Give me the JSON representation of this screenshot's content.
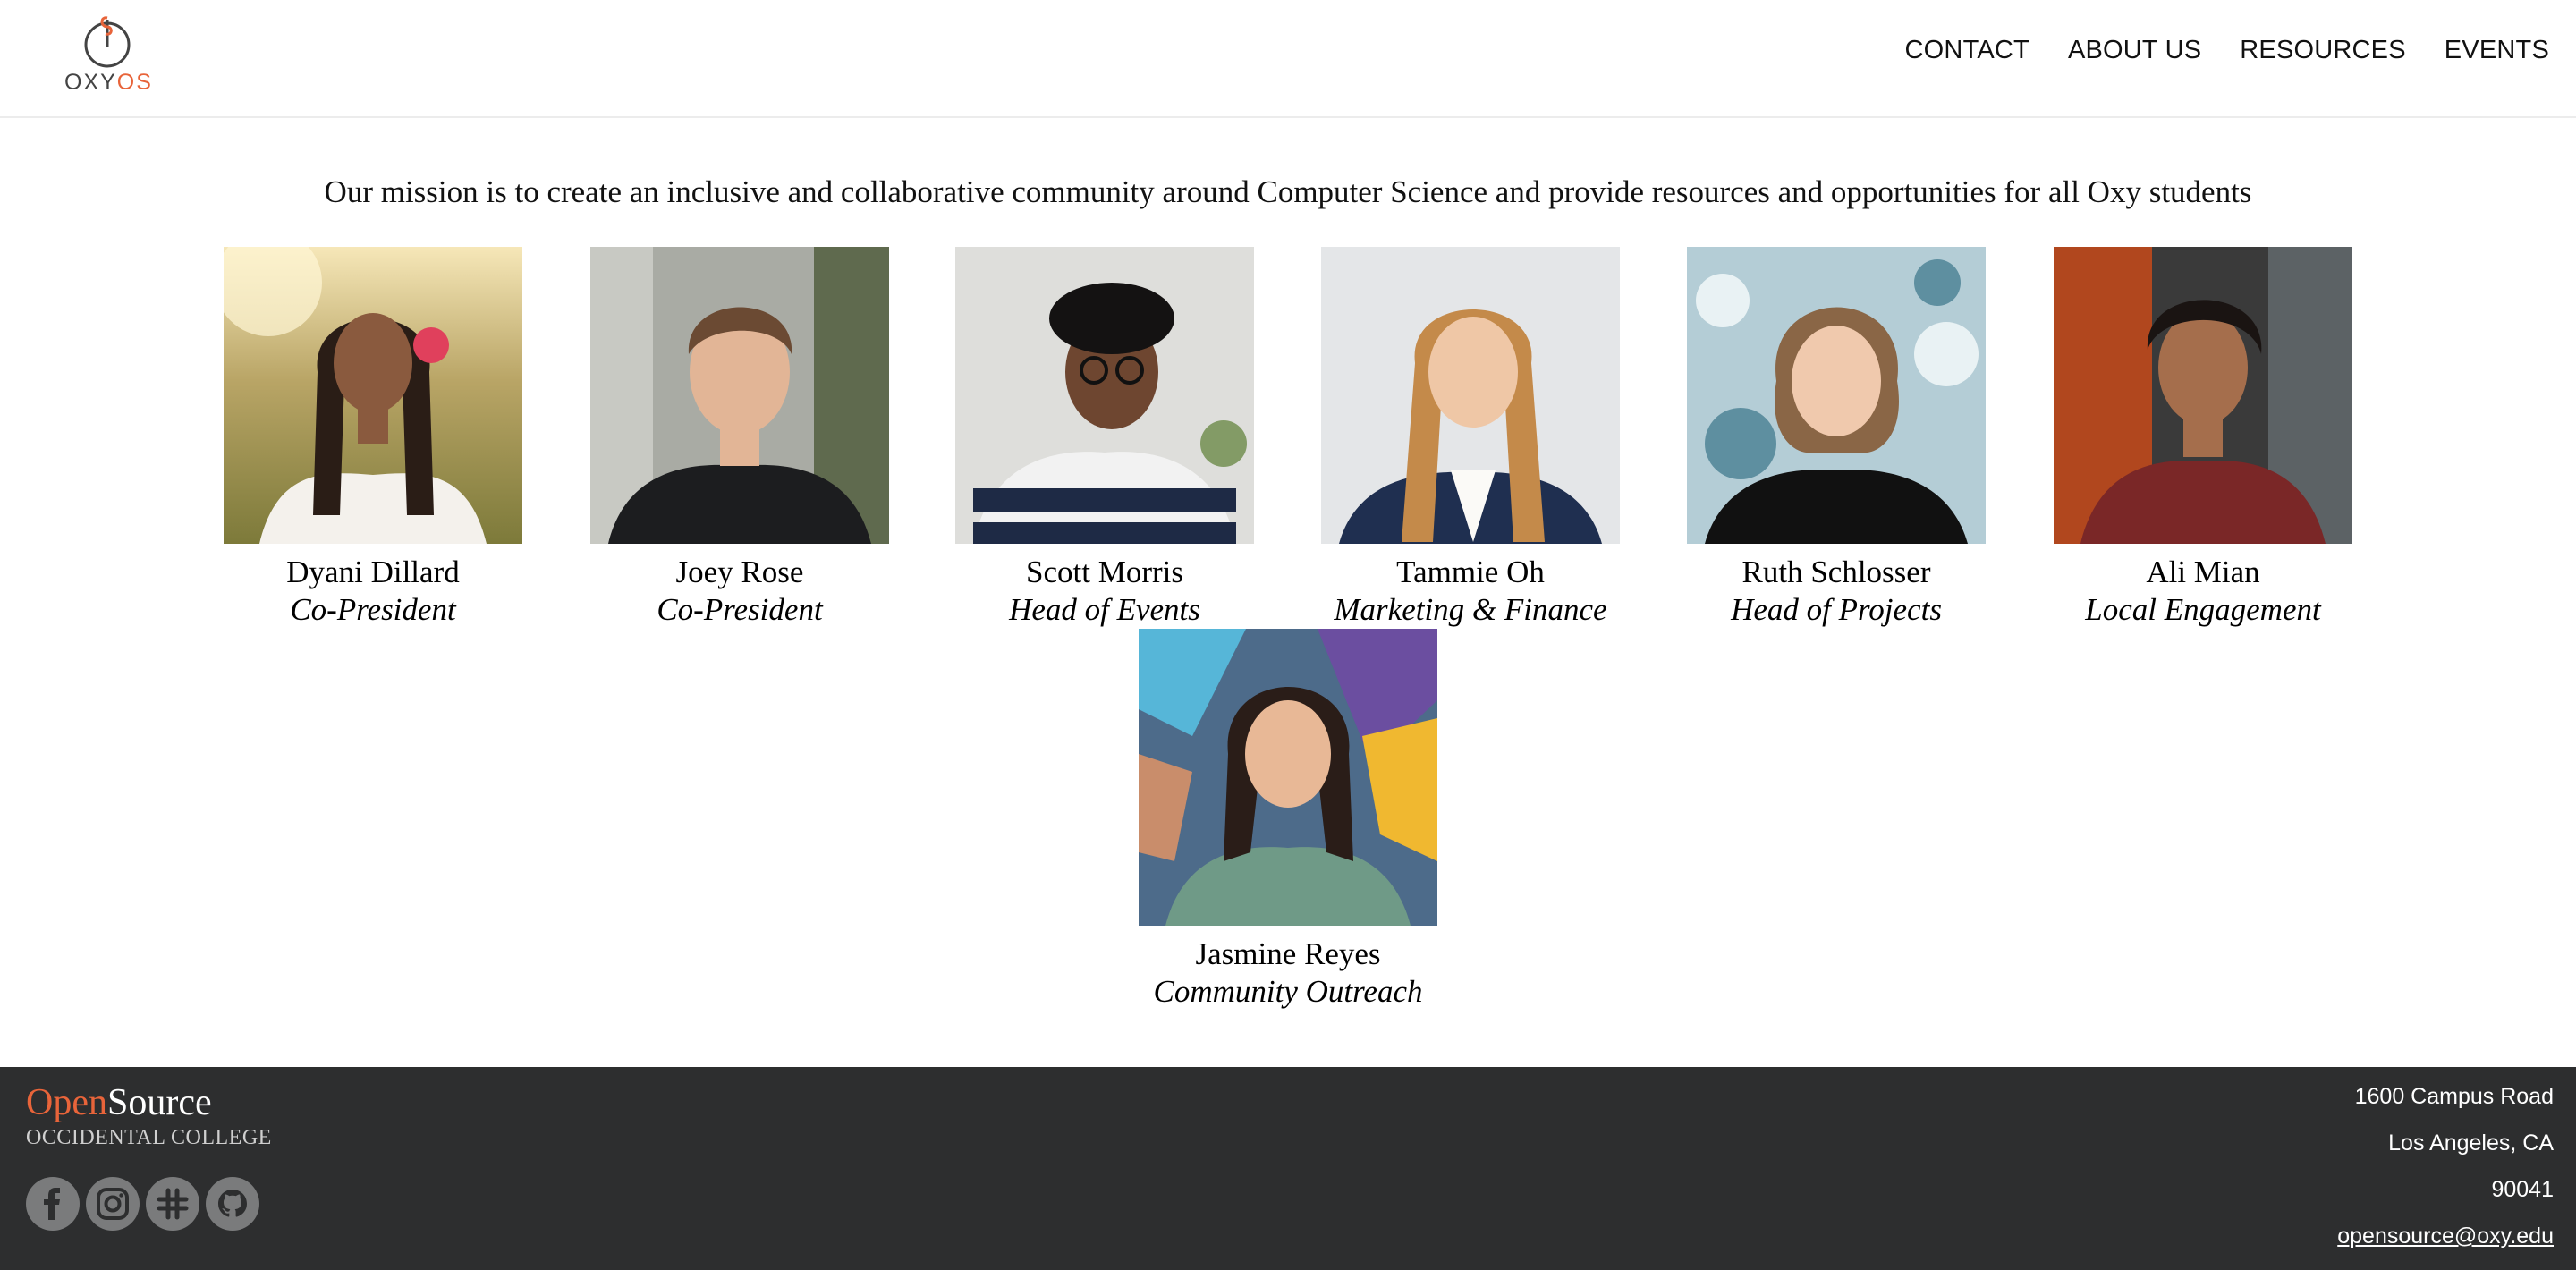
{
  "logo": {
    "prefix": "OXY",
    "accent": "OS"
  },
  "nav": [
    {
      "label": "CONTACT"
    },
    {
      "label": "ABOUT US"
    },
    {
      "label": "RESOURCES"
    },
    {
      "label": "EVENTS"
    }
  ],
  "mission": "Our mission is to create an inclusive and collaborative community around Computer Science and provide resources and opportunities for all Oxy students",
  "team": [
    {
      "name": "Dyani Dillard",
      "role": "Co-President"
    },
    {
      "name": "Joey Rose",
      "role": "Co-President"
    },
    {
      "name": "Scott Morris",
      "role": "Head of Events"
    },
    {
      "name": "Tammie Oh",
      "role": "Marketing & Finance"
    },
    {
      "name": "Ruth Schlosser",
      "role": "Head of Projects"
    },
    {
      "name": "Ali Mian",
      "role": "Local Engagement"
    },
    {
      "name": "Jasmine Reyes",
      "role": "Community Outreach"
    }
  ],
  "footer": {
    "brand_open": "Open",
    "brand_source": "Source",
    "college": "OCCIDENTAL COLLEGE",
    "socials": [
      "facebook-icon",
      "instagram-icon",
      "slack-icon",
      "github-icon"
    ],
    "address": {
      "street": "1600 Campus Road",
      "city": "Los Angeles, CA",
      "zip": "90041",
      "email": "opensource@oxy.edu"
    }
  },
  "colors": {
    "accent": "#e8643a",
    "footer_bg": "#2d2e2f"
  }
}
